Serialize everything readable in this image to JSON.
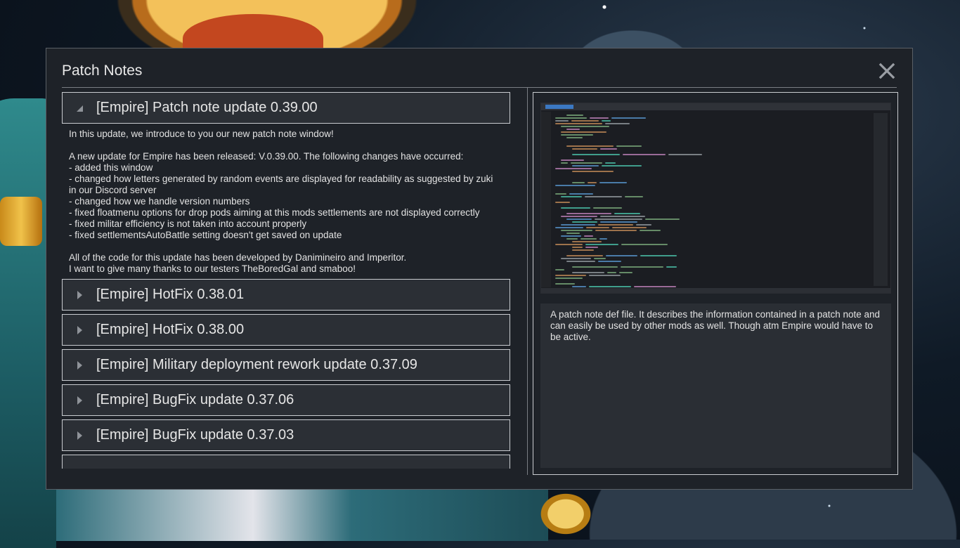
{
  "window": {
    "title": "Patch Notes",
    "close_icon": "close-icon"
  },
  "entries": [
    {
      "label": "[Empire] Patch note update 0.39.00",
      "expanded": true,
      "body": [
        "In this update, we introduce to you our new patch note window!",
        "",
        "A new update for Empire has been released: V.0.39.00. The following changes have occurred:",
        "- added this window",
        "- changed how letters generated by random events are displayed for readability as suggested by zuki in our Discord server",
        "- changed how we handle version numbers",
        "- fixed floatmenu options for drop pods aiming at this mods settlements are not displayed correctly",
        "- fixed militar efficiency is not taken into account properly",
        "- fixed settlementsAutoBattle setting doesn't get saved on update",
        "",
        "All of the code for this update has been developed by Danimineiro and Imperitor.",
        "I want to give many thanks to our testers TheBoredGal and smaboo!"
      ]
    },
    {
      "label": "[Empire] HotFix 0.38.01",
      "expanded": false
    },
    {
      "label": "[Empire] HotFix 0.38.00",
      "expanded": false
    },
    {
      "label": "[Empire] Military deployment rework update 0.37.09",
      "expanded": false
    },
    {
      "label": "[Empire] BugFix update 0.37.06",
      "expanded": false
    },
    {
      "label": "[Empire] BugFix update 0.37.03",
      "expanded": false
    }
  ],
  "preview": {
    "image": "code-editor-screenshot",
    "description": "A patch note def file. It describes the information contained in a patch note and can easily be used by other mods as well. Though atm Empire would have to be active."
  },
  "colors": {
    "window_bg": "#1e2228",
    "header_bg": "#2b2f35",
    "border": "#c9ccd0",
    "text": "#e2e2e2"
  }
}
